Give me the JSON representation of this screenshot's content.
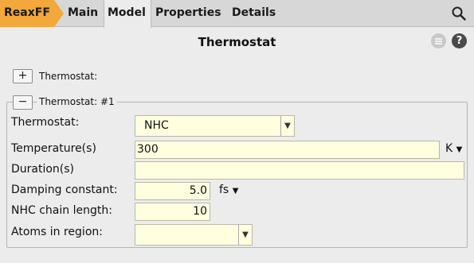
{
  "tabs": {
    "app": "ReaxFF",
    "main": "Main",
    "model": "Model",
    "properties": "Properties",
    "details": "Details"
  },
  "icons": {
    "search": "magnifier-icon",
    "menu": "hamburger-icon",
    "help": "question-mark-icon"
  },
  "help_glyph": "?",
  "title": "Thermostat",
  "collapsed_section": {
    "toggle": "+",
    "label": "Thermostat:"
  },
  "expanded_section": {
    "toggle": "−",
    "label": "Thermostat: #1"
  },
  "fields": {
    "thermostat": {
      "label": "Thermostat:",
      "value": "NHC"
    },
    "temperature": {
      "label": "Temperature(s)",
      "value": "300",
      "unit": "K"
    },
    "duration": {
      "label": "Duration(s)",
      "value": ""
    },
    "damping": {
      "label": "Damping constant:",
      "value": "5.0",
      "unit": "fs"
    },
    "nhc_chain": {
      "label": "NHC chain length:",
      "value": "10"
    },
    "atoms_region": {
      "label": "Atoms in region:",
      "value": ""
    }
  },
  "colors": {
    "accent": "#f2a83b",
    "field_bg": "#ffffe0",
    "panel_bg": "#ececec",
    "tabbar_bg": "#d7d7d7"
  }
}
